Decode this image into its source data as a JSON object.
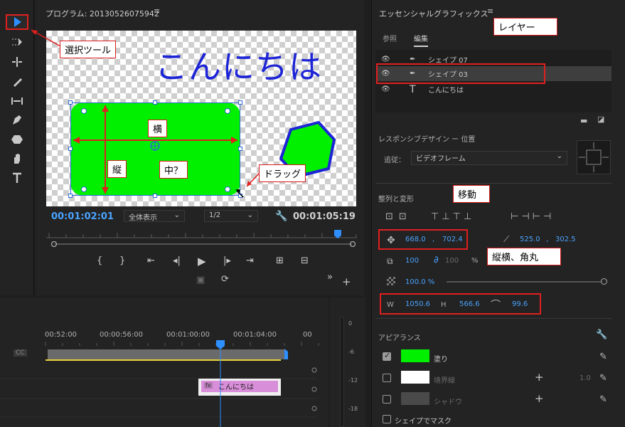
{
  "program": {
    "title": "プログラム: 20130526075942",
    "menu_icon": "≡",
    "canvas_text": "こんにちは",
    "timecode_current": "00:01:02:01",
    "zoom": "全体表示",
    "resolution": "1/2",
    "timecode_duration": "00:01:05:19"
  },
  "annotations": {
    "select_tool": "選択ツール",
    "horizontal": "横",
    "vertical": "縦",
    "center": "中？",
    "drag": "ドラッグ",
    "layer": "レイヤー",
    "move": "移動",
    "size_corner": "縦横、角丸"
  },
  "timeline": {
    "ticks": [
      "00:52:00",
      "00:00:56:00",
      "00:01:00:00",
      "00:01:04:00",
      "00"
    ],
    "clip_label": "こんにちは",
    "cc": "CC",
    "db": [
      "0",
      "-6",
      "-12",
      "-18"
    ]
  },
  "essential_graphics": {
    "title": "エッセンシャルグラフィックス",
    "menu_icon": "≡",
    "tabs": [
      "参照",
      "編集"
    ],
    "layers": [
      {
        "name": "シェイプ 07",
        "type": "shape"
      },
      {
        "name": "シェイプ 03",
        "type": "shape"
      },
      {
        "name": "こんにちは",
        "type": "text"
      }
    ],
    "responsive_title": "レスポンシブデザイン ー 位置",
    "follow_label": "追従：",
    "follow_value": "ビデオフレーム",
    "align_title": "整列と変形",
    "position": {
      "x": "668.0",
      "sep": ",",
      "y": "702.4"
    },
    "anchor": {
      "x": "525.0",
      "sep": ",",
      "y": "302.5"
    },
    "scale": {
      "value": "100",
      "value2": "100",
      "unit": "%"
    },
    "opacity": "100.0 %",
    "size": {
      "w_label": "W",
      "w": "1050.6",
      "h_label": "H",
      "h": "566.6",
      "radius": "99.6"
    },
    "appearance_title": "アピアランス",
    "fill": {
      "label": "塗り",
      "color": "#00f000",
      "checked": true
    },
    "stroke": {
      "label": "境界線",
      "value": "1.0",
      "color": "#ffffff"
    },
    "shadow": {
      "label": "シャドウ",
      "color": "#4a4a4a"
    },
    "mask_label": "シェイプでマスク"
  },
  "colors": {
    "accent": "#4aa3ff",
    "annotation": "#e01f1f",
    "fill_green": "#00f000"
  }
}
